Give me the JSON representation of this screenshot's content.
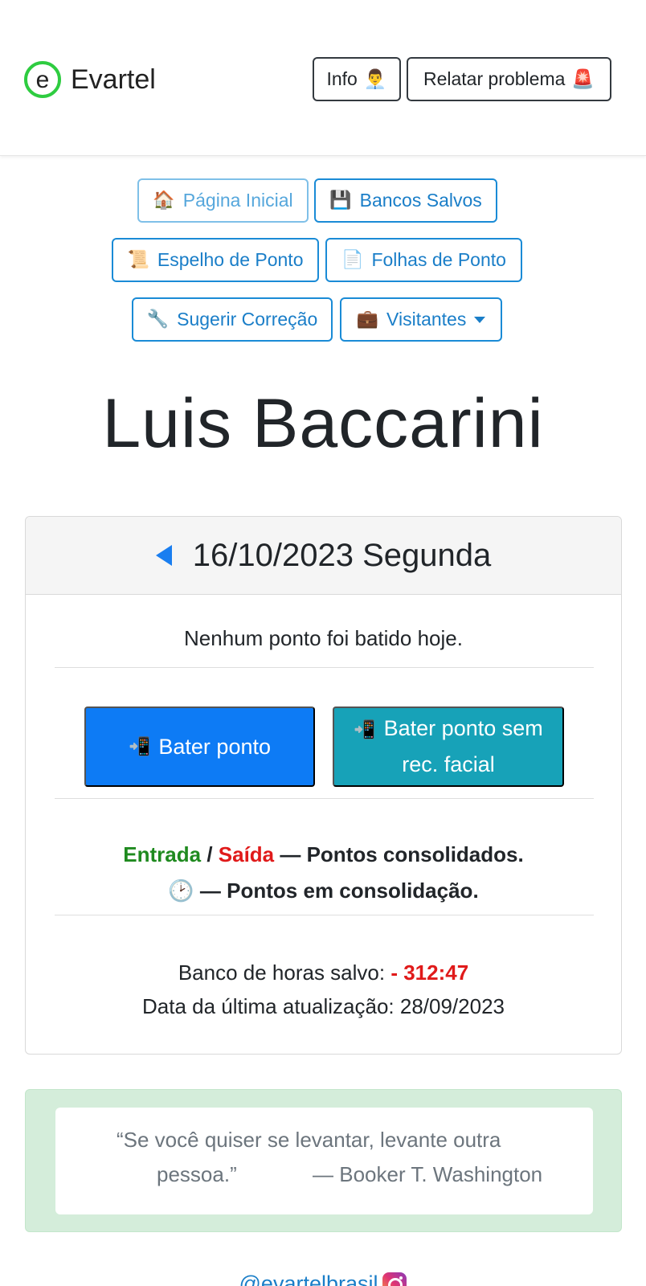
{
  "brand": {
    "name": "Evartel",
    "logo_letter": "e",
    "accent": "#2ecc40"
  },
  "nav": {
    "info_label": "Info",
    "info_emoji": "👨‍💼",
    "report_label": "Relatar problema",
    "report_emoji": "🚨"
  },
  "menu": {
    "home": {
      "icon": "🏠",
      "label": "Página Inicial"
    },
    "saved_banks": {
      "icon": "💾",
      "label": "Bancos Salvos"
    },
    "timesheet_mirror": {
      "icon": "📜",
      "label": "Espelho de Ponto"
    },
    "timesheets": {
      "icon": "📄",
      "label": "Folhas de Ponto"
    },
    "suggest_fix": {
      "icon": "🔧",
      "label": "Sugerir Correção"
    },
    "visitors": {
      "icon": "💼",
      "label": "Visitantes"
    }
  },
  "person": {
    "name": "Luis Baccarini"
  },
  "day_card": {
    "date_label": "16/10/2023 Segunda",
    "no_punch_text": "Nenhum ponto foi batido hoje.",
    "punch_button": {
      "icon": "📲",
      "label": "Bater ponto"
    },
    "punch_no_face_button": {
      "icon": "📲",
      "line1": "Bater ponto sem",
      "line2": "rec. facial"
    },
    "legend": {
      "entrada": "Entrada",
      "slash": " / ",
      "saida": "Saída",
      "consolidated": " — Pontos consolidados.",
      "clock_icon": "🕑",
      "in_consolidation": " — Pontos em consolidação."
    },
    "bank_label": "Banco de horas salvo: ",
    "bank_value": "- 312:47",
    "last_update_label": "Data da última atualização: ",
    "last_update_value": "28/09/2023"
  },
  "quote": {
    "line1": "“Se você quiser se levantar, levante outra",
    "line2": "pessoa.”",
    "author": "— Booker T. Washington"
  },
  "footer": {
    "instagram_handle": "@evartelbrasil"
  }
}
